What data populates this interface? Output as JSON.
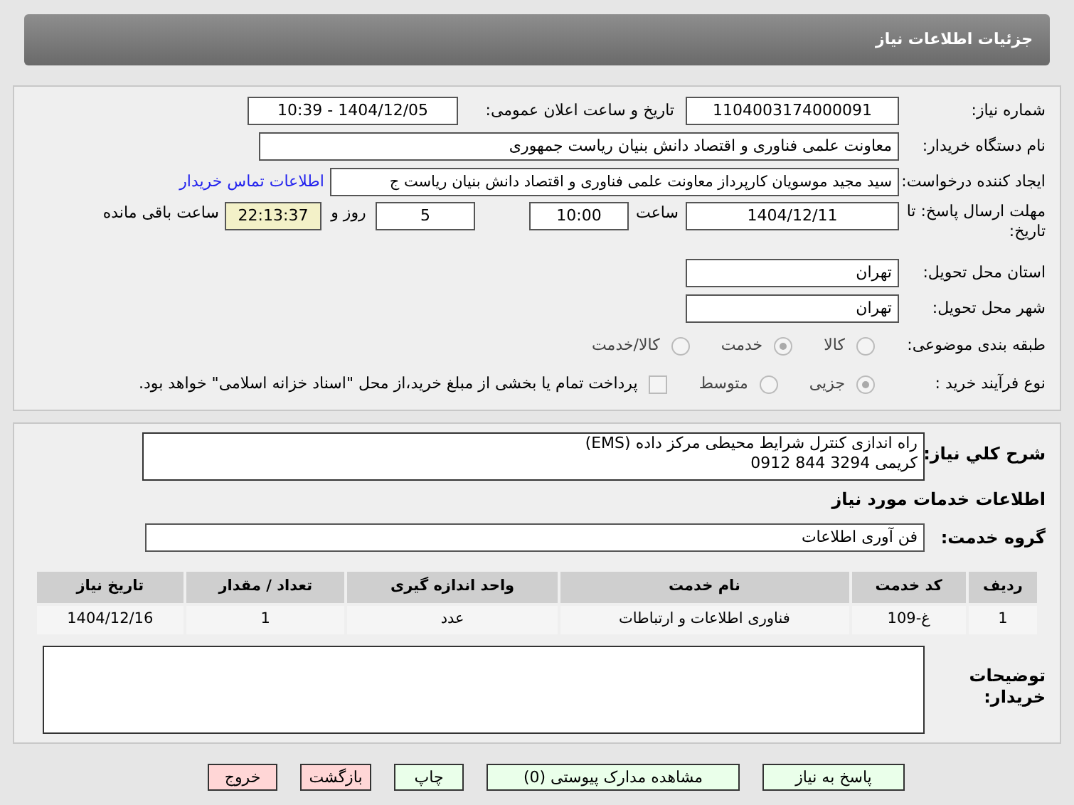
{
  "header": {
    "title": "جزئیات اطلاعات نیاز"
  },
  "need_number": {
    "label": "شماره نیاز:",
    "value": "1104003174000091"
  },
  "announce": {
    "label": "تاریخ و ساعت اعلان عمومی:",
    "value": "1404/12/05 - 10:39"
  },
  "buyer_org": {
    "label": "نام دستگاه خریدار:",
    "value": "معاونت علمی فناوری و اقتصاد دانش بنیان ریاست جمهوری"
  },
  "requester": {
    "label": "ایجاد کننده درخواست:",
    "value": "سید مجید موسویان کارپرداز معاونت علمی فناوری و اقتصاد دانش بنیان ریاست ج",
    "link": "اطلاعات تماس خریدار"
  },
  "deadline": {
    "label": "مهلت ارسال پاسخ: تا تاریخ:",
    "date": "1404/12/11",
    "time_label": "ساعت",
    "time": "10:00",
    "days": "5",
    "days_label": "روز و",
    "remaining": "22:13:37",
    "remaining_label": "ساعت باقی مانده"
  },
  "province": {
    "label": "استان محل تحویل:",
    "value": "تهران"
  },
  "city": {
    "label": "شهر محل تحویل:",
    "value": "تهران"
  },
  "category": {
    "label": "طبقه بندی موضوعی:",
    "options": [
      {
        "label": "کالا",
        "selected": false
      },
      {
        "label": "خدمت",
        "selected": true
      },
      {
        "label": "کالا/خدمت",
        "selected": false
      }
    ]
  },
  "process": {
    "label": "نوع فرآیند خرید :",
    "options": [
      {
        "label": "جزیی",
        "selected": true
      },
      {
        "label": "متوسط",
        "selected": false
      }
    ],
    "payment": {
      "label": "پرداخت تمام یا بخشی از مبلغ خرید،از محل \"اسناد خزانه اسلامی\" خواهد بود.",
      "checked": false
    }
  },
  "description": {
    "label": "شرح کلي نياز:",
    "lines": [
      "راه اندازی کنترل شرایط محیطی مرکز داده (EMS)",
      "کریمی   3294 844 0912"
    ]
  },
  "services_title": "اطلاعات خدمات مورد نیاز",
  "service_group": {
    "label": "گروه خدمت:",
    "value": "فن آوری اطلاعات"
  },
  "table": {
    "columns": [
      "ردیف",
      "کد خدمت",
      "نام خدمت",
      "واحد اندازه گیری",
      "تعداد / مقدار",
      "تاریخ نیاز"
    ],
    "rows": [
      [
        "1",
        "غ-109",
        "فناوری اطلاعات و ارتباطات",
        "عدد",
        "1",
        "1404/12/16"
      ]
    ]
  },
  "buyer_notes": {
    "label": "توضیحات خریدار:"
  },
  "buttons": [
    {
      "label": "پاسخ به نیاز",
      "kind": "normal"
    },
    {
      "label": "مشاهده مدارک پیوستی (0)",
      "kind": "normal"
    },
    {
      "label": "چاپ",
      "kind": "normal"
    },
    {
      "label": "بازگشت",
      "kind": "danger"
    },
    {
      "label": "خروج",
      "kind": "danger"
    }
  ]
}
